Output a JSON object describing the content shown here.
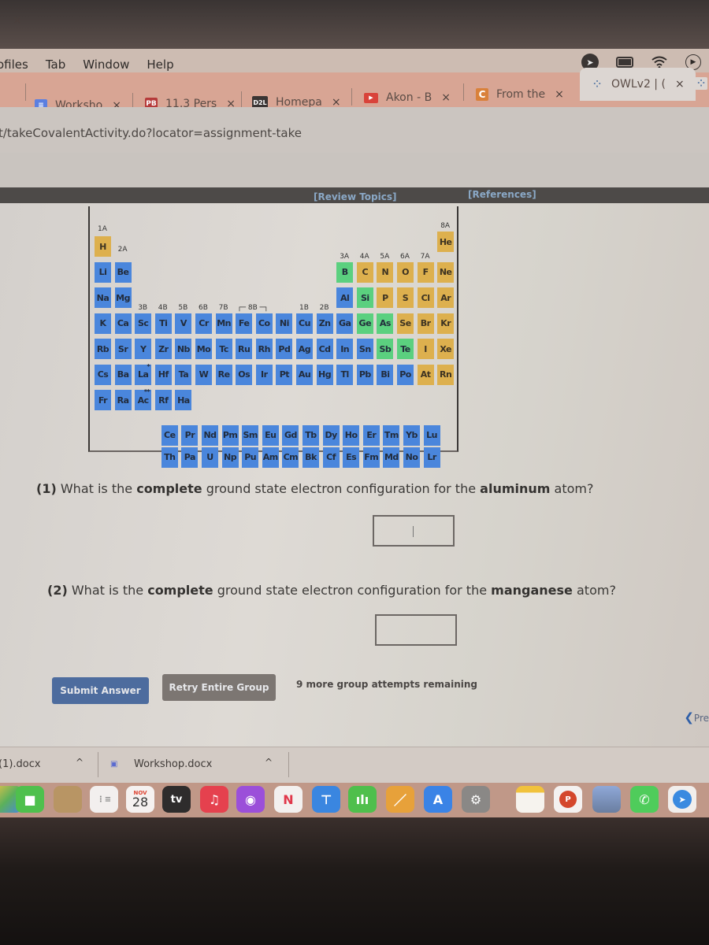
{
  "menubar": {
    "items": [
      "ofiles",
      "Tab",
      "Window",
      "Help"
    ]
  },
  "status_icons": [
    "location-icon",
    "battery-icon",
    "wifi-icon",
    "media-play-icon"
  ],
  "tabs": [
    {
      "label": "",
      "close": "×"
    },
    {
      "label": "Worksho",
      "favicon": "docs",
      "close": "×"
    },
    {
      "label": "11.3 Pers",
      "favicon": "PB",
      "close": "×"
    },
    {
      "label": "Homepa",
      "favicon": "D2L",
      "close": "×"
    },
    {
      "label": "Akon - B",
      "favicon": "youtube",
      "close": "×"
    },
    {
      "label": "From the",
      "favicon": "C",
      "close": "×"
    },
    {
      "label": "OWLv2 | (",
      "favicon": "owl",
      "close": "×",
      "active": true
    }
  ],
  "address": {
    "url": "t/takeCovalentActivity.do?locator=assignment-take"
  },
  "owl_header": {
    "review_topics": "[Review Topics]",
    "references": "[References]"
  },
  "periodic_table": {
    "group_labels": {
      "g1": "1A",
      "g2": "2A",
      "g3b": "3B",
      "g4b": "4B",
      "g5b": "5B",
      "g6b": "6B",
      "g7b": "7B",
      "g8b": "8B",
      "g1b": "1B",
      "g2b": "2B",
      "g3a": "3A",
      "g4a": "4A",
      "g5a": "5A",
      "g6a": "6A",
      "g7a": "7A",
      "g8a": "8A"
    },
    "rows": [
      [
        {
          "s": "H",
          "t": "nonmetal",
          "c": 1
        },
        {
          "s": "He",
          "t": "nonmetal",
          "c": 18
        }
      ],
      [
        {
          "s": "Li",
          "t": "metal",
          "c": 1
        },
        {
          "s": "Be",
          "t": "metal",
          "c": 2
        },
        {
          "s": "B",
          "t": "metalloid",
          "c": 13
        },
        {
          "s": "C",
          "t": "nonmetal",
          "c": 14
        },
        {
          "s": "N",
          "t": "nonmetal",
          "c": 15
        },
        {
          "s": "O",
          "t": "nonmetal",
          "c": 16
        },
        {
          "s": "F",
          "t": "nonmetal",
          "c": 17
        },
        {
          "s": "Ne",
          "t": "nonmetal",
          "c": 18
        }
      ],
      [
        {
          "s": "Na",
          "t": "metal",
          "c": 1
        },
        {
          "s": "Mg",
          "t": "metal",
          "c": 2
        },
        {
          "s": "Al",
          "t": "metal",
          "c": 13
        },
        {
          "s": "Si",
          "t": "metalloid",
          "c": 14
        },
        {
          "s": "P",
          "t": "nonmetal",
          "c": 15
        },
        {
          "s": "S",
          "t": "nonmetal",
          "c": 16
        },
        {
          "s": "Cl",
          "t": "nonmetal",
          "c": 17
        },
        {
          "s": "Ar",
          "t": "nonmetal",
          "c": 18
        }
      ],
      [
        {
          "s": "K",
          "t": "metal",
          "c": 1
        },
        {
          "s": "Ca",
          "t": "metal",
          "c": 2
        },
        {
          "s": "Sc",
          "t": "metal",
          "c": 3
        },
        {
          "s": "Ti",
          "t": "metal",
          "c": 4
        },
        {
          "s": "V",
          "t": "metal",
          "c": 5
        },
        {
          "s": "Cr",
          "t": "metal",
          "c": 6
        },
        {
          "s": "Mn",
          "t": "metal",
          "c": 7
        },
        {
          "s": "Fe",
          "t": "metal",
          "c": 8
        },
        {
          "s": "Co",
          "t": "metal",
          "c": 9
        },
        {
          "s": "Ni",
          "t": "metal",
          "c": 10
        },
        {
          "s": "Cu",
          "t": "metal",
          "c": 11
        },
        {
          "s": "Zn",
          "t": "metal",
          "c": 12
        },
        {
          "s": "Ga",
          "t": "metal",
          "c": 13
        },
        {
          "s": "Ge",
          "t": "metalloid",
          "c": 14
        },
        {
          "s": "As",
          "t": "metalloid",
          "c": 15
        },
        {
          "s": "Se",
          "t": "nonmetal",
          "c": 16
        },
        {
          "s": "Br",
          "t": "nonmetal",
          "c": 17
        },
        {
          "s": "Kr",
          "t": "nonmetal",
          "c": 18
        }
      ],
      [
        {
          "s": "Rb",
          "t": "metal",
          "c": 1
        },
        {
          "s": "Sr",
          "t": "metal",
          "c": 2
        },
        {
          "s": "Y",
          "t": "metal",
          "c": 3
        },
        {
          "s": "Zr",
          "t": "metal",
          "c": 4
        },
        {
          "s": "Nb",
          "t": "metal",
          "c": 5
        },
        {
          "s": "Mo",
          "t": "metal",
          "c": 6
        },
        {
          "s": "Tc",
          "t": "metal",
          "c": 7
        },
        {
          "s": "Ru",
          "t": "metal",
          "c": 8
        },
        {
          "s": "Rh",
          "t": "metal",
          "c": 9
        },
        {
          "s": "Pd",
          "t": "metal",
          "c": 10
        },
        {
          "s": "Ag",
          "t": "metal",
          "c": 11
        },
        {
          "s": "Cd",
          "t": "metal",
          "c": 12
        },
        {
          "s": "In",
          "t": "metal",
          "c": 13
        },
        {
          "s": "Sn",
          "t": "metal",
          "c": 14
        },
        {
          "s": "Sb",
          "t": "metalloid",
          "c": 15
        },
        {
          "s": "Te",
          "t": "metalloid",
          "c": 16
        },
        {
          "s": "I",
          "t": "nonmetal",
          "c": 17
        },
        {
          "s": "Xe",
          "t": "nonmetal",
          "c": 18
        }
      ],
      [
        {
          "s": "Cs",
          "t": "metal",
          "c": 1
        },
        {
          "s": "Ba",
          "t": "metal",
          "c": 2
        },
        {
          "s": "La*",
          "t": "metal",
          "c": 3
        },
        {
          "s": "Hf",
          "t": "metal",
          "c": 4
        },
        {
          "s": "Ta",
          "t": "metal",
          "c": 5
        },
        {
          "s": "W",
          "t": "metal",
          "c": 6
        },
        {
          "s": "Re",
          "t": "metal",
          "c": 7
        },
        {
          "s": "Os",
          "t": "metal",
          "c": 8
        },
        {
          "s": "Ir",
          "t": "metal",
          "c": 9
        },
        {
          "s": "Pt",
          "t": "metal",
          "c": 10
        },
        {
          "s": "Au",
          "t": "metal",
          "c": 11
        },
        {
          "s": "Hg",
          "t": "metal",
          "c": 12
        },
        {
          "s": "Tl",
          "t": "metal",
          "c": 13
        },
        {
          "s": "Pb",
          "t": "metal",
          "c": 14
        },
        {
          "s": "Bi",
          "t": "metal",
          "c": 15
        },
        {
          "s": "Po",
          "t": "metal",
          "c": 16
        },
        {
          "s": "At",
          "t": "nonmetal",
          "c": 17
        },
        {
          "s": "Rn",
          "t": "nonmetal",
          "c": 18
        }
      ],
      [
        {
          "s": "Fr",
          "t": "metal",
          "c": 1
        },
        {
          "s": "Ra",
          "t": "metal",
          "c": 2
        },
        {
          "s": "Ac**",
          "t": "metal",
          "c": 3
        },
        {
          "s": "Rf",
          "t": "metal",
          "c": 4
        },
        {
          "s": "Ha",
          "t": "metal",
          "c": 5
        }
      ]
    ],
    "lanthanides": [
      "Ce",
      "Pr",
      "Nd",
      "Pm",
      "Sm",
      "Eu",
      "Gd",
      "Tb",
      "Dy",
      "Ho",
      "Er",
      "Tm",
      "Yb",
      "Lu"
    ],
    "actinides": [
      "Th",
      "Pa",
      "U",
      "Np",
      "Pu",
      "Am",
      "Cm",
      "Bk",
      "Cf",
      "Es",
      "Fm",
      "Md",
      "No",
      "Lr"
    ],
    "colors": {
      "metal": "#4a86dc",
      "metalloid": "#5bd07f",
      "nonmetal": "#ddb04e"
    }
  },
  "questions": [
    {
      "number": "(1)",
      "pre": "What is the",
      "bold1": "complete",
      "mid": "ground state electron configuration for the",
      "bold2": "aluminum",
      "post": "atom?",
      "answer": ""
    },
    {
      "number": "(2)",
      "pre": "What is the",
      "bold1": "complete",
      "mid": "ground state electron configuration for the",
      "bold2": "manganese",
      "post": "atom?",
      "answer": ""
    }
  ],
  "actions": {
    "submit": "Submit Answer",
    "retry": "Retry Entire Group",
    "attempts": "9 more group attempts remaining",
    "prev": "Pre"
  },
  "downloads": [
    {
      "name": "(1).docx",
      "caret": "^"
    },
    {
      "name": "Workshop.docx",
      "caret": "^"
    }
  ],
  "dock": {
    "calendar_month": "NOV",
    "calendar_day": "28",
    "tv_label": "tv",
    "apps": [
      "finder-like-icon",
      "facetime-icon",
      "folder-icon",
      "reminders-icon",
      "calendar-icon",
      "apple-tv-icon",
      "music-icon",
      "podcasts-icon",
      "news-icon",
      "keynote-icon",
      "numbers-icon",
      "pages-icon",
      "app-store-icon",
      "system-preferences-icon",
      "notes-icon",
      "powerpoint-icon",
      "preview-icon",
      "whatsapp-icon",
      "telegram-icon"
    ]
  }
}
